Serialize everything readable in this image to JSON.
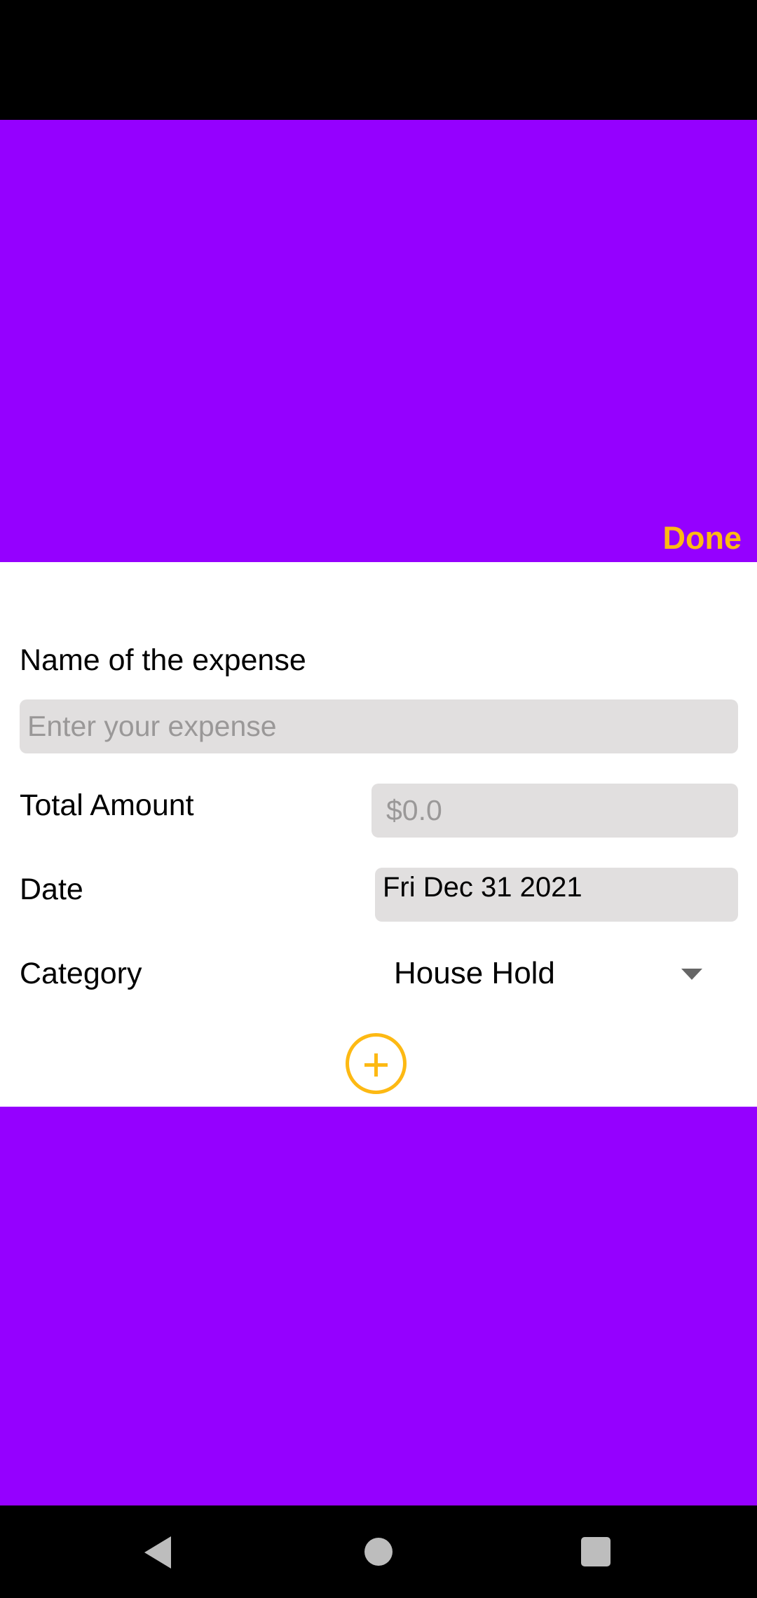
{
  "header": {
    "done_label": "Done"
  },
  "form": {
    "name_label": "Name of the expense",
    "name_placeholder": "Enter your expense",
    "amount_label": "Total Amount",
    "amount_placeholder": "$0.0",
    "date_label": "Date",
    "date_value": "Fri Dec 31 2021",
    "category_label": "Category",
    "category_value": "House Hold"
  },
  "icons": {
    "add": "plus-circle-icon",
    "dropdown": "chevron-down-icon",
    "back": "back-triangle-icon",
    "home": "home-circle-icon",
    "recents": "recents-square-icon"
  },
  "colors": {
    "accent": "#fdb913",
    "background": "#9500ff",
    "field": "#e1dfdf"
  }
}
